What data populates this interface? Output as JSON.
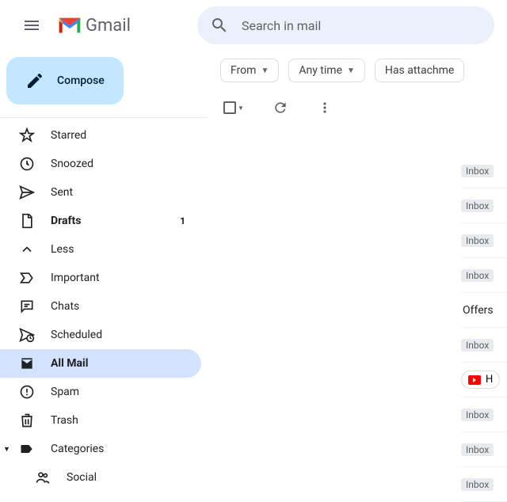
{
  "header": {
    "app_name": "Gmail",
    "search_placeholder": "Search in mail"
  },
  "compose_label": "Compose",
  "sidebar": {
    "items": [
      {
        "label": "Starred",
        "icon": "star"
      },
      {
        "label": "Snoozed",
        "icon": "clock"
      },
      {
        "label": "Sent",
        "icon": "send"
      },
      {
        "label": "Drafts",
        "icon": "file",
        "bold": true,
        "count": "1"
      },
      {
        "label": "Less",
        "icon": "chevron-up"
      },
      {
        "label": "Important",
        "icon": "important"
      },
      {
        "label": "Chats",
        "icon": "chat"
      },
      {
        "label": "Scheduled",
        "icon": "scheduled"
      },
      {
        "label": "All Mail",
        "icon": "mail",
        "selected": true
      },
      {
        "label": "Spam",
        "icon": "spam"
      },
      {
        "label": "Trash",
        "icon": "trash"
      },
      {
        "label": "Categories",
        "icon": "tag",
        "expanded": true
      },
      {
        "label": "Social",
        "icon": "people",
        "sub": true
      }
    ]
  },
  "chips": [
    {
      "label": "From",
      "caret": true
    },
    {
      "label": "Any time",
      "caret": true
    },
    {
      "label": "Has attachme",
      "caret": false
    }
  ],
  "inbox_tag": "Inbox",
  "offers_label": "Offers",
  "youtube_label": "H"
}
